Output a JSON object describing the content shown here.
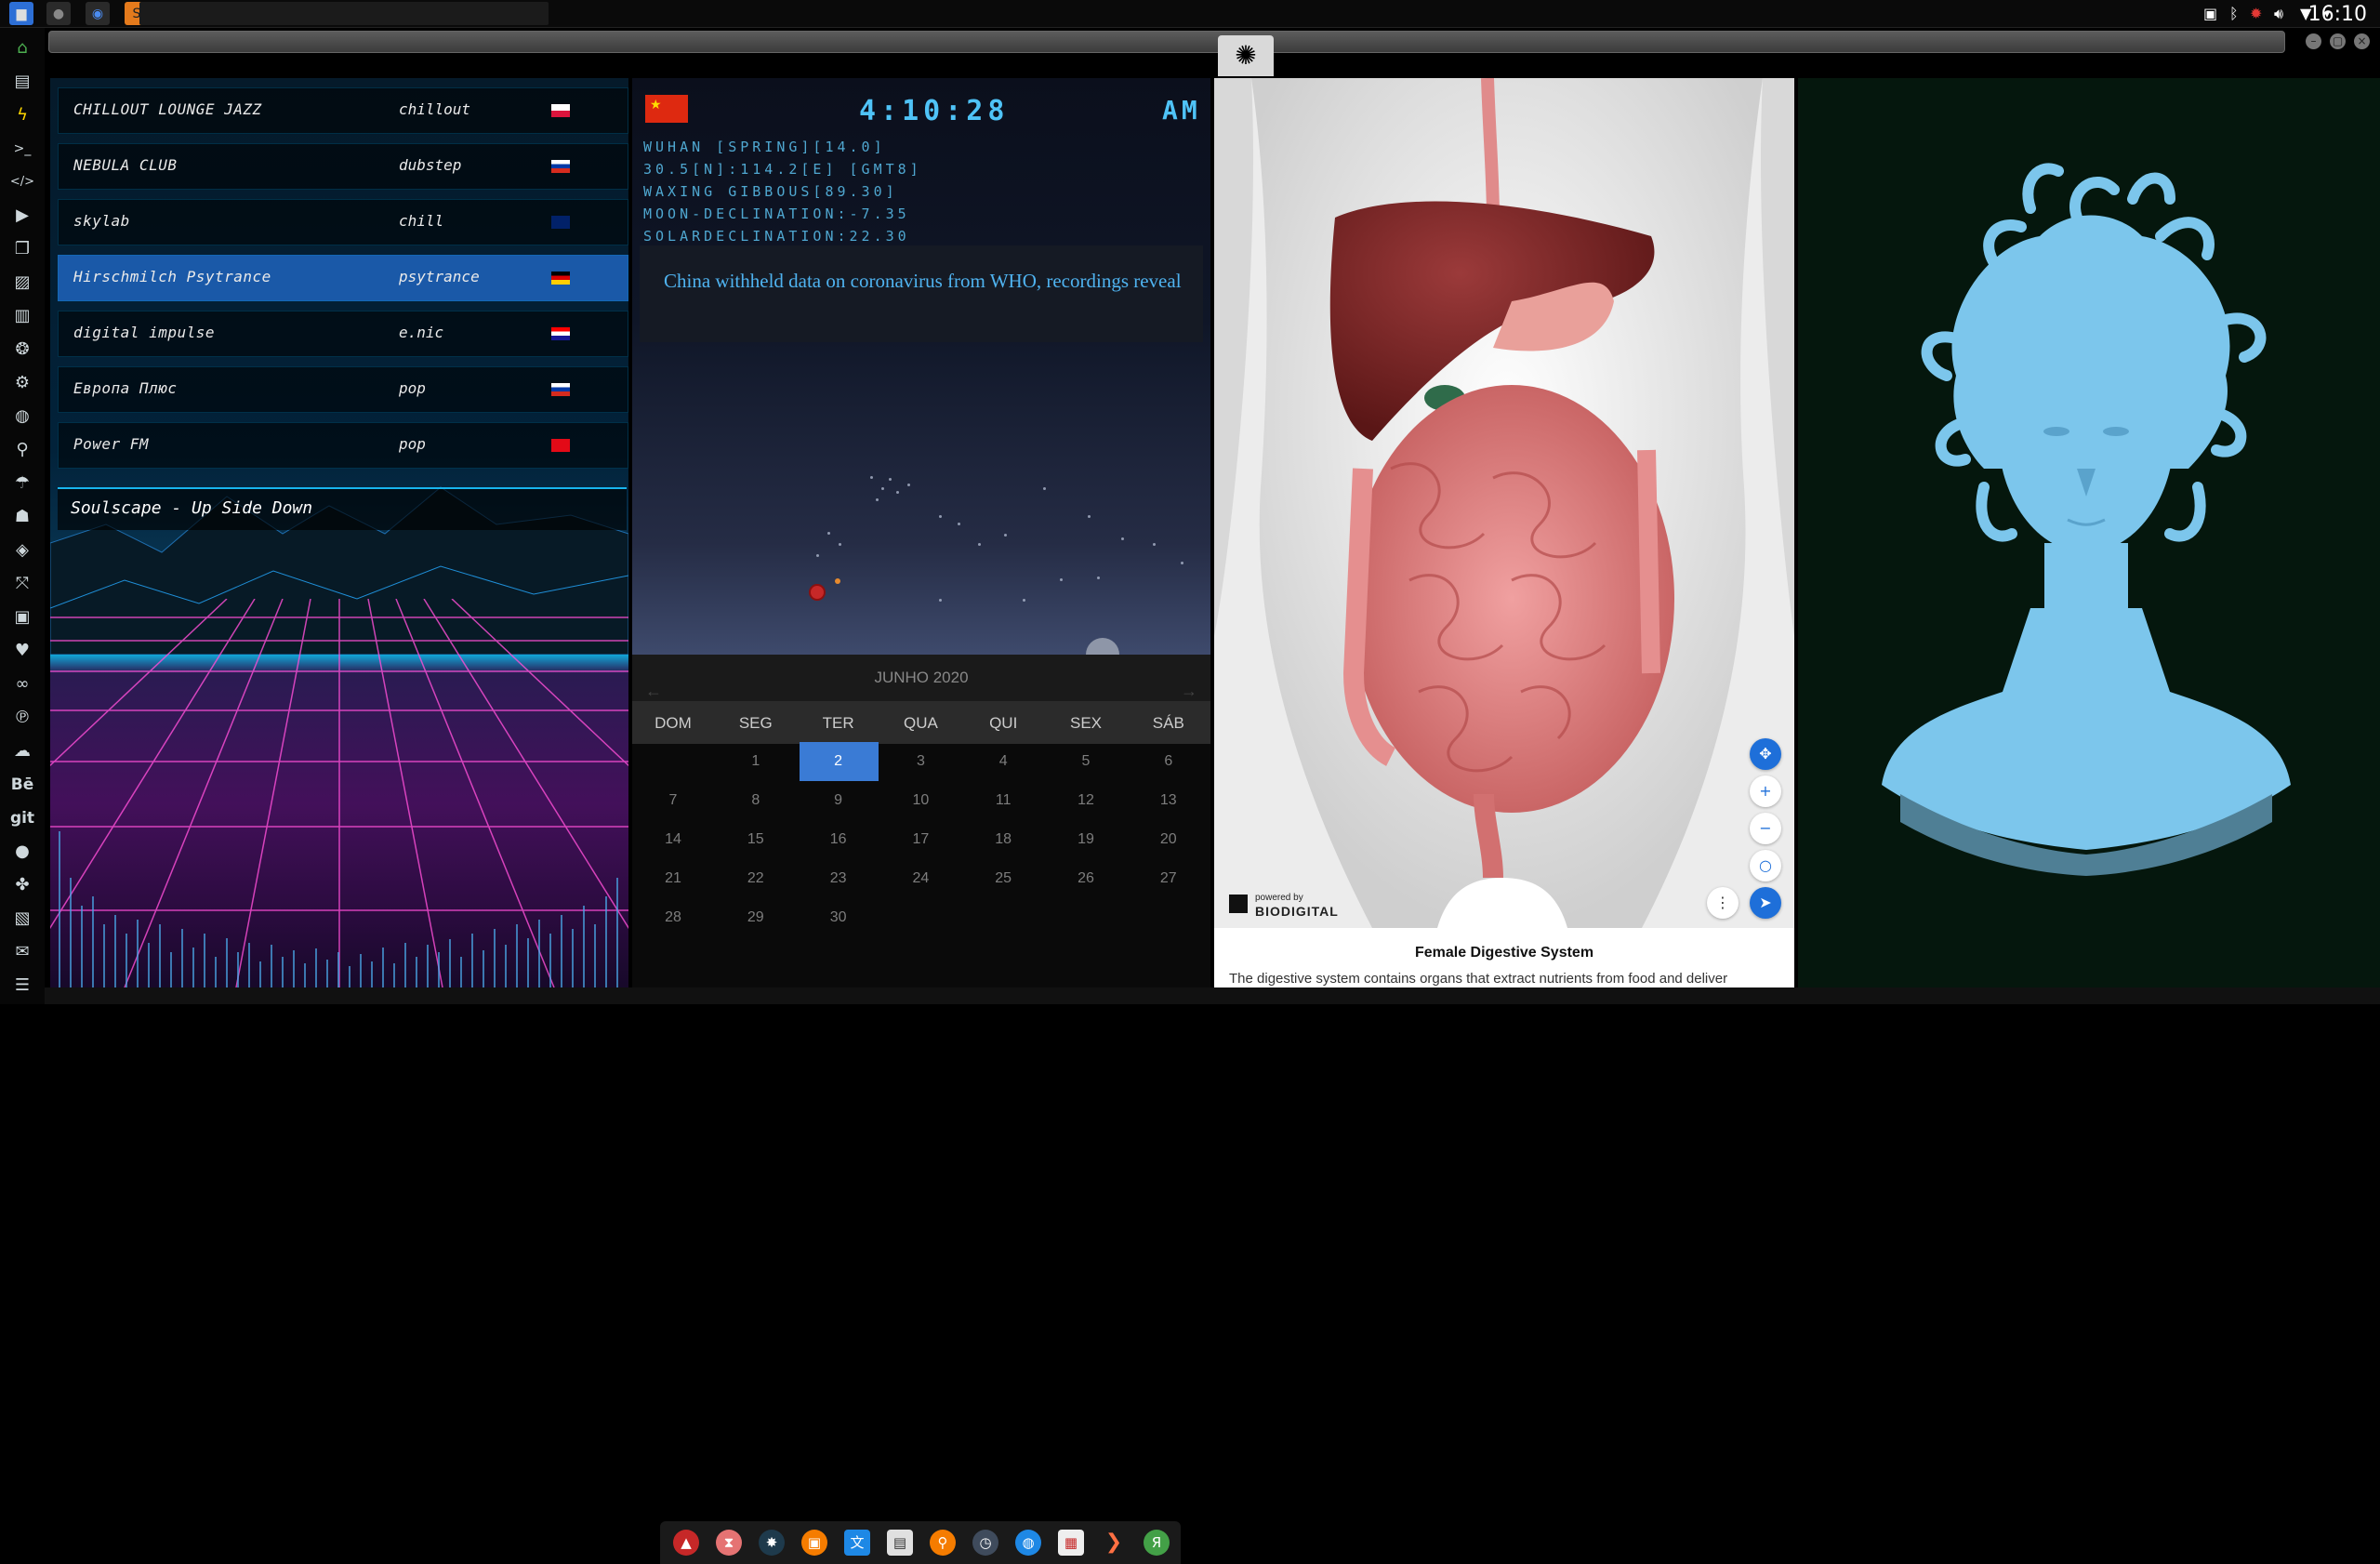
{
  "system": {
    "clock": "16:10",
    "tray_icons": [
      "image-icon",
      "bluetooth-icon",
      "bug-icon",
      "volume-icon",
      "wifi-icon",
      "chevron-down-icon"
    ]
  },
  "launcher": {
    "icons": [
      "home-icon",
      "document-icon",
      "lightning-icon",
      "terminal-icon",
      "code-icon",
      "play-icon",
      "copy-icon",
      "image-icon",
      "book-icon",
      "aperture-icon",
      "gear-icon",
      "globe-icon",
      "search-icon",
      "umbrella-icon",
      "contact-icon",
      "tag-icon",
      "expand-icon",
      "youtube-icon",
      "heart-icon",
      "infinity-icon",
      "pinterest-icon",
      "cloud-icon",
      "behance-icon",
      "git-icon",
      "github-icon",
      "puzzle-icon",
      "map-icon",
      "mail-icon",
      "list-icon"
    ],
    "labels": {
      "behance": "Bē",
      "git": "git"
    }
  },
  "radio": {
    "stations": [
      {
        "name": "CHILLOUT LOUNGE JAZZ",
        "genre": "chillout",
        "flag": "poland"
      },
      {
        "name": "NEBULA CLUB",
        "genre": "dubstep",
        "flag": "russia"
      },
      {
        "name": "skylab",
        "genre": "chill",
        "flag": "uk"
      },
      {
        "name": "Hirschmilch Psytrance",
        "genre": "psytrance",
        "flag": "germany"
      },
      {
        "name": "digital impulse",
        "genre": "e.nic",
        "flag": "croatia"
      },
      {
        "name": "Европа Плюс",
        "genre": "pop",
        "flag": "russia"
      },
      {
        "name": "Power FM",
        "genre": "pop",
        "flag": "turkey"
      }
    ],
    "selected_index": 3,
    "now_playing": "Soulscape - Up Side Down"
  },
  "clockpanel": {
    "flag": "china",
    "time": "4:10:28",
    "ampm": "AM",
    "info": [
      "WUHAN [SPRING][14.0]",
      "30.5[N]:114.2[E] [GMT8]",
      "WAXING GIBBOUS[89.30]",
      "MOON-DECLINATION:-7.35",
      "SOLARDECLINATION:22.30"
    ],
    "news": "China withheld data on coronavirus from WHO, recordings reveal"
  },
  "calendar": {
    "month": "JUNHO 2020",
    "prev_arrow": "←",
    "next_arrow": "→",
    "days": [
      "DOM",
      "SEG",
      "TER",
      "QUA",
      "QUI",
      "SEX",
      "SÁB"
    ],
    "weeks": [
      [
        "",
        "1",
        "2",
        "3",
        "4",
        "5",
        "6"
      ],
      [
        "7",
        "8",
        "9",
        "10",
        "11",
        "12",
        "13"
      ],
      [
        "14",
        "15",
        "16",
        "17",
        "18",
        "19",
        "20"
      ],
      [
        "21",
        "22",
        "23",
        "24",
        "25",
        "26",
        "27"
      ],
      [
        "28",
        "29",
        "30",
        "",
        "",
        "",
        ""
      ]
    ],
    "today": "2"
  },
  "dock": {
    "icons": [
      "arch-icon",
      "hourglass-icon",
      "planet-icon",
      "photo-icon",
      "translate-icon",
      "news-icon",
      "magnifier-icon",
      "clock-icon",
      "globe-icon",
      "calendar-icon",
      "arrow-icon",
      "yandex-icon"
    ]
  },
  "anatomy": {
    "powered_by": "powered by",
    "brand": "BIODIGITAL",
    "title": "Female Digestive System",
    "description": "The digestive system contains organs that extract nutrients from food and deliver",
    "tools": [
      "move-icon",
      "zoom-in-icon",
      "zoom-out-icon",
      "reset-icon",
      "more-icon",
      "navigate-icon"
    ]
  },
  "window": {
    "logo": "rebel-alliance-icon"
  }
}
